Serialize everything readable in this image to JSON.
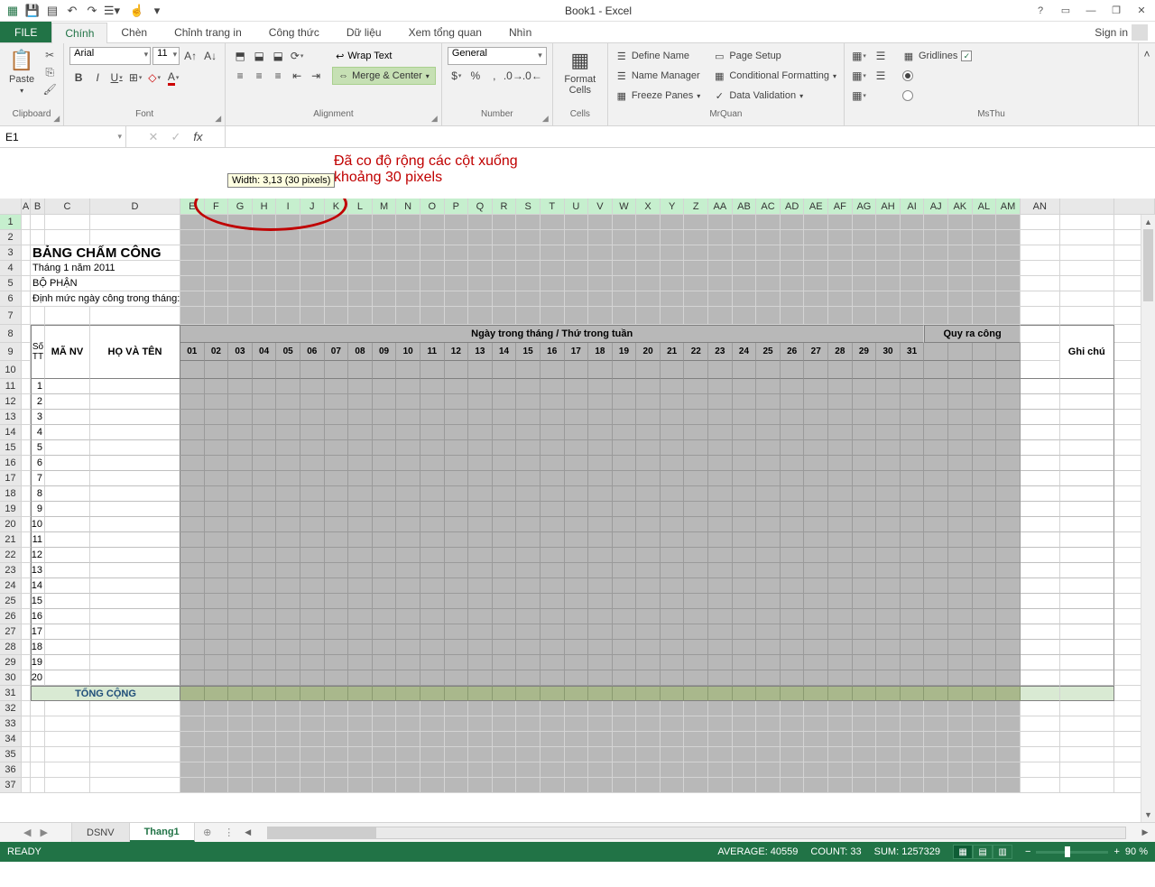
{
  "title": "Book1 - Excel",
  "signin": "Sign in",
  "tabs": {
    "file": "FILE",
    "chinh": "Chính",
    "chen": "Chèn",
    "chinhtrangin": "Chỉnh trang in",
    "congthuc": "Công thức",
    "dulieu": "Dữ liệu",
    "xemtongquan": "Xem tổng quan",
    "nhin": "Nhìn"
  },
  "ribbon": {
    "clipboard": {
      "paste": "Paste",
      "label": "Clipboard"
    },
    "font": {
      "name": "Arial",
      "size": "11",
      "label": "Font"
    },
    "align": {
      "wrap": "Wrap Text",
      "merge": "Merge & Center",
      "label": "Alignment"
    },
    "number": {
      "format": "General",
      "label": "Number"
    },
    "cells": {
      "format": "Format Cells",
      "label": "Cells"
    },
    "mrquan": {
      "define": "Define Name",
      "namemgr": "Name Manager",
      "freeze": "Freeze Panes",
      "pagesetup": "Page Setup",
      "condfmt": "Conditional Formatting",
      "dataval": "Data Validation",
      "label": "MrQuan"
    },
    "msthu": {
      "gridlines": "Gridlines",
      "label": "MsThu"
    }
  },
  "namebox": "E1",
  "annot": {
    "line1": "Đã co độ rộng các cột xuống",
    "line2": "khoảng 30 pixels",
    "tooltip": "Width: 3,13 (30 pixels)"
  },
  "columns": {
    "sel": [
      "E",
      "F",
      "G",
      "H",
      "I",
      "J"
    ],
    "rest": [
      "K",
      "L",
      "M",
      "N",
      "O",
      "P",
      "Q",
      "R",
      "S",
      "T",
      "U",
      "V",
      "W",
      "X",
      "Y",
      "Z",
      "AA",
      "AB",
      "AC",
      "AD",
      "AE",
      "AF",
      "AG",
      "AH",
      "AI",
      "AJ",
      "AK",
      "AL",
      "AM"
    ],
    "after": "AN"
  },
  "rows": [
    1,
    2,
    3,
    4,
    5,
    6,
    7,
    8,
    9,
    10,
    11,
    12,
    13,
    14,
    15,
    16,
    17,
    18,
    19,
    20,
    21,
    22,
    23,
    24,
    25,
    26,
    27,
    28,
    29,
    30,
    31,
    32,
    33,
    34,
    35,
    36,
    37
  ],
  "sheet": {
    "title": "BẢNG CHẤM CÔNG",
    "thang": "Tháng 1 năm 2011",
    "bophan": "BỘ PHẬN",
    "dinhmuc": "Định mức ngày công trong tháng:",
    "hdr_day": "Ngày trong tháng / Thứ trong tuần",
    "hdr_quy": "Quy ra công",
    "hdr_stt": "Số TT",
    "hdr_manv": "MÃ NV",
    "hdr_hoten": "HỌ VÀ TÊN",
    "hdr_ghichu": "Ghi chú",
    "days": [
      "01",
      "02",
      "03",
      "04",
      "05",
      "06",
      "07",
      "08",
      "09",
      "10",
      "11",
      "12",
      "13",
      "14",
      "15",
      "16",
      "17",
      "18",
      "19",
      "20",
      "21",
      "22",
      "23",
      "24",
      "25",
      "26",
      "27",
      "28",
      "29",
      "30",
      "31"
    ],
    "seq": [
      1,
      2,
      3,
      4,
      5,
      6,
      7,
      8,
      9,
      10,
      11,
      12,
      13,
      14,
      15,
      16,
      17,
      18,
      19,
      20
    ],
    "total": "TỔNG CỘNG"
  },
  "sheettabs": {
    "dsnv": "DSNV",
    "thang1": "Thang1"
  },
  "status": {
    "ready": "READY",
    "avg": "AVERAGE: 40559",
    "count": "COUNT: 33",
    "sum": "SUM: 1257329",
    "zoom": "90 %"
  }
}
